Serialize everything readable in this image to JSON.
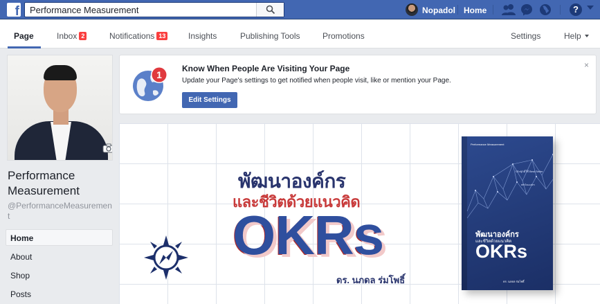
{
  "topbar": {
    "search_value": "Performance Measurement",
    "user_name": "Nopadol",
    "home_label": "Home"
  },
  "pagenav": {
    "page": "Page",
    "inbox": "Inbox",
    "inbox_count": "2",
    "notifications": "Notifications",
    "notifications_count": "13",
    "insights": "Insights",
    "publishing_tools": "Publishing Tools",
    "promotions": "Promotions",
    "settings": "Settings",
    "help": "Help"
  },
  "profile": {
    "page_name": "Performance Measurement",
    "handle": "@PerformanceMeasurement"
  },
  "sidebar": {
    "items": [
      {
        "label": "Home"
      },
      {
        "label": "About"
      },
      {
        "label": "Shop"
      },
      {
        "label": "Posts"
      }
    ]
  },
  "notice": {
    "badge_count": "1",
    "title": "Know When People Are Visiting Your Page",
    "body": "Update your Page's settings to get notified when people visit, like or mention your Page.",
    "button": "Edit Settings",
    "close": "×"
  },
  "cover": {
    "title_line1": "พัฒนาองค์กร",
    "title_line2": "และชีวิตด้วยแนวคิด",
    "headline": "OKRs",
    "author": "ดร. นภดล ร่มโพธิ์",
    "book": {
      "top_label": "Performance Measurement",
      "tag1": "ประยุกต์ใช้ Best Seller",
      "tag2": "พลิกโฉมองค์กร",
      "title_line1": "พัฒนาองค์กร",
      "title_line2": "และชีวิตด้วยแนวคิด",
      "headline": "OKRs",
      "author": "ดร. นภดล ร่มโพธิ์"
    }
  },
  "colors": {
    "facebook_blue": "#4267b2",
    "badge_red": "#fa3e3e",
    "cover_navy": "#29346d",
    "cover_red": "#c83a3a"
  },
  "icons": [
    "facebook-logo-icon",
    "search-icon",
    "friend-requests-icon",
    "messenger-icon",
    "globe-icon",
    "help-icon",
    "camera-icon",
    "compass-icon"
  ]
}
